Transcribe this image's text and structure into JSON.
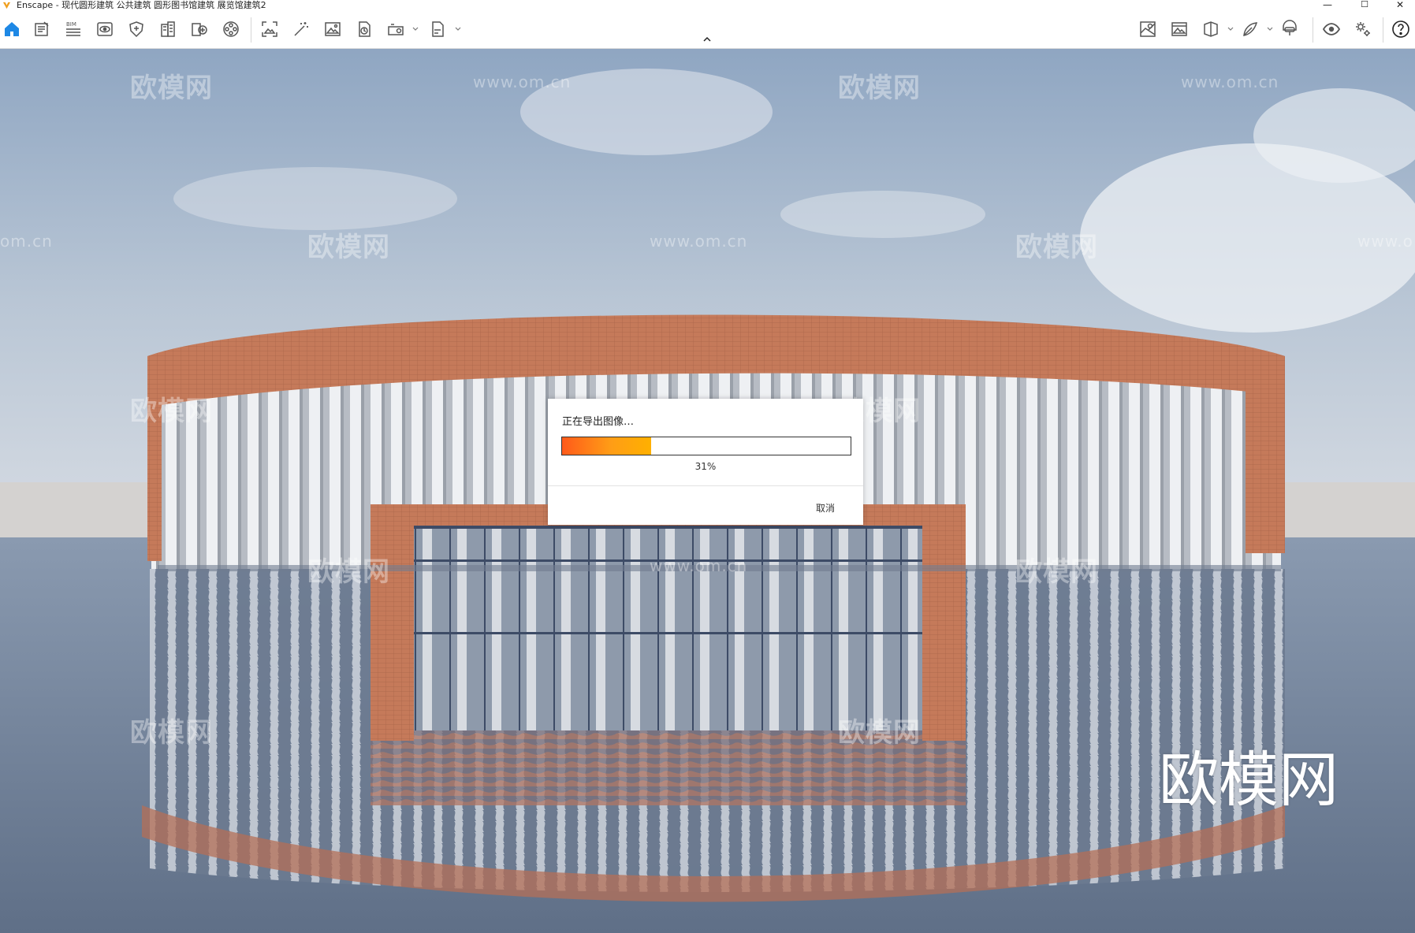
{
  "window": {
    "title": "Enscape - 现代圆形建筑 公共建筑 圆形图书馆建筑 展览馆建筑2",
    "controls": {
      "minimize": "—",
      "maximize": "☐",
      "close": "✕"
    }
  },
  "toolbar": {
    "left_icons": [
      "home-icon",
      "project-icon",
      "bim-icon",
      "view-icon",
      "shield-icon",
      "building-icon",
      "asset-library-icon",
      "material-icon",
      "screenshot-icon",
      "magic-wand-icon",
      "image-icon",
      "panorama-icon",
      "360-export-icon",
      "exe-export-icon"
    ],
    "bim_label": "BIM",
    "collapse_glyph": "^",
    "right_icons": [
      "map-icon",
      "image-gallery-icon",
      "section-icon",
      "feather-icon",
      "vr-headset-icon",
      "eye-icon",
      "settings-icon",
      "help-icon"
    ],
    "accent_color": "#1e88e5"
  },
  "watermarks": {
    "brand": "欧模网",
    "url": "www.om.cn",
    "url_partial_left": "om.cn",
    "url_partial_right": "www.o"
  },
  "dialog": {
    "message": "正在导出图像…",
    "progress_fraction": 0.31,
    "progress_text": "31%",
    "cancel_label": "取消"
  },
  "big_watermark": "欧模网"
}
